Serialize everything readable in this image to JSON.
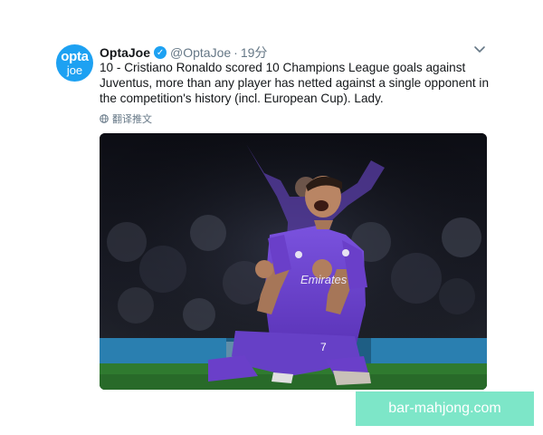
{
  "tweet": {
    "avatar": {
      "line1": "opta",
      "line2": "joe"
    },
    "name": "OptaJoe",
    "handle": "@OptaJoe",
    "separator": "·",
    "time": "19分",
    "text": "10 - Cristiano Ronaldo scored 10 Champions League goals against Juventus, more than any player has netted against a single opponent in the competition's history (incl. European Cup). Lady.",
    "translate_label": "翻译推文"
  },
  "photo": {
    "jersey_sponsor": "Emirates",
    "jersey_number": "7"
  },
  "icons": {
    "verified": "verified-badge-icon",
    "menu": "chevron-down-icon",
    "translate": "globe-icon"
  },
  "colors": {
    "accent": "#1da1f2",
    "jersey": "#6a3fc9",
    "watermark_bg": "#7de6c8"
  },
  "watermark": "bar-mahjong.com"
}
